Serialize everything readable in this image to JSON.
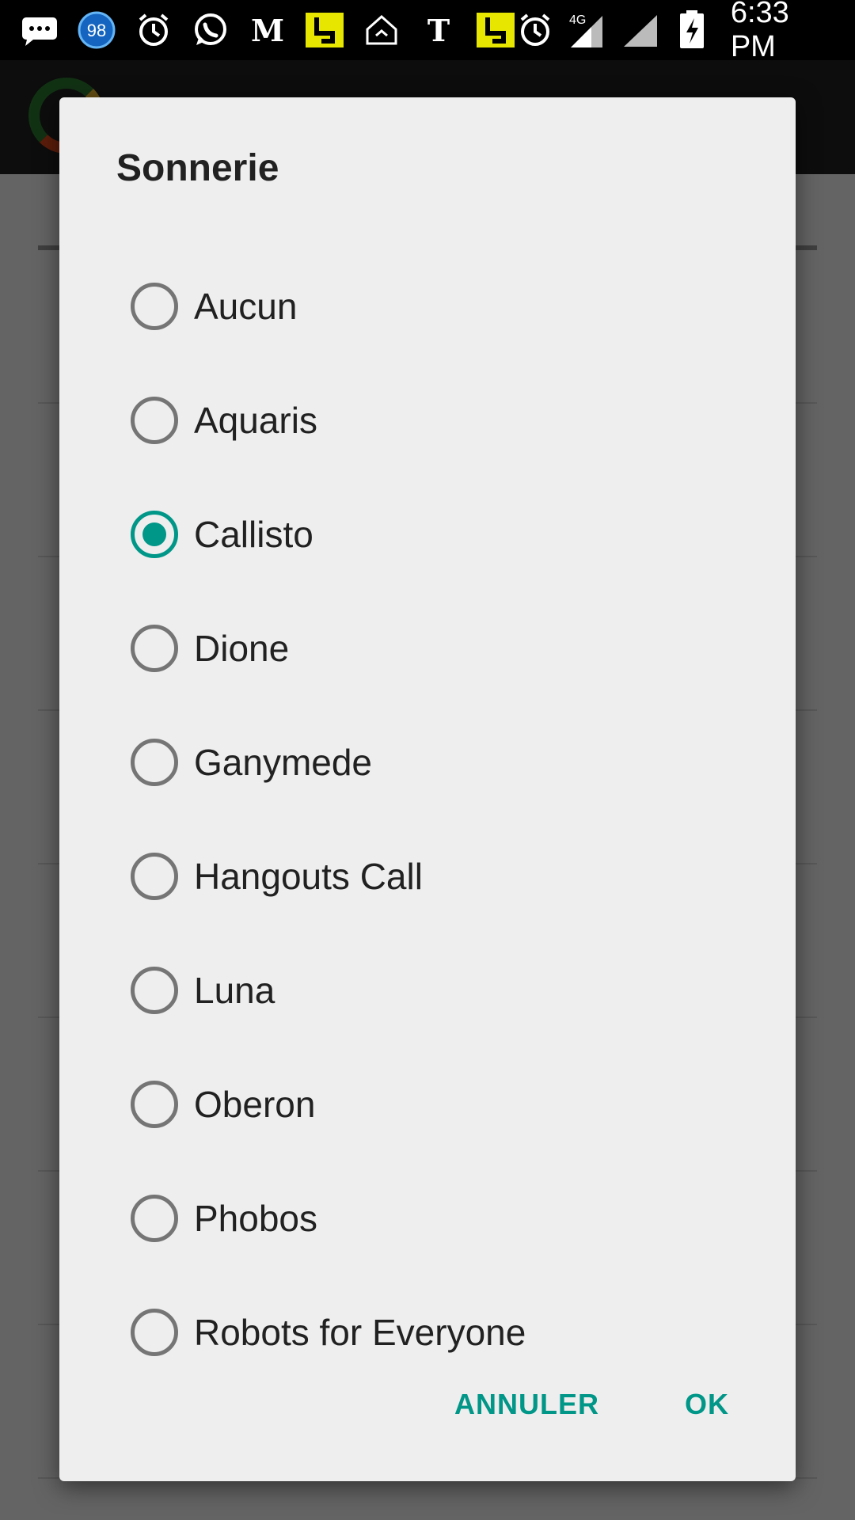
{
  "status_bar": {
    "time": "6:33 PM",
    "network": "4G",
    "notification_count": "98",
    "icons": [
      "messages-icon",
      "battery-saver-icon",
      "alarm-icon",
      "whatsapp-icon",
      "le-monde-icon",
      "yellow-app-icon",
      "home-icon",
      "nytimes-icon",
      "yellow-app-icon",
      "alarm-icon",
      "signal-icon",
      "signal-icon",
      "battery-charging-icon"
    ]
  },
  "dialog": {
    "title": "Sonnerie",
    "selected": "Callisto",
    "options": [
      {
        "label": "Aucun"
      },
      {
        "label": "Aquaris"
      },
      {
        "label": "Callisto"
      },
      {
        "label": "Dione"
      },
      {
        "label": "Ganymede"
      },
      {
        "label": "Hangouts Call"
      },
      {
        "label": "Luna"
      },
      {
        "label": "Oberon"
      },
      {
        "label": "Phobos"
      },
      {
        "label": "Robots for Everyone"
      }
    ],
    "cancel_label": "ANNULER",
    "ok_label": "OK"
  },
  "colors": {
    "accent": "#009688",
    "dialog_background": "#eeeeee",
    "status_bar": "#000000"
  }
}
